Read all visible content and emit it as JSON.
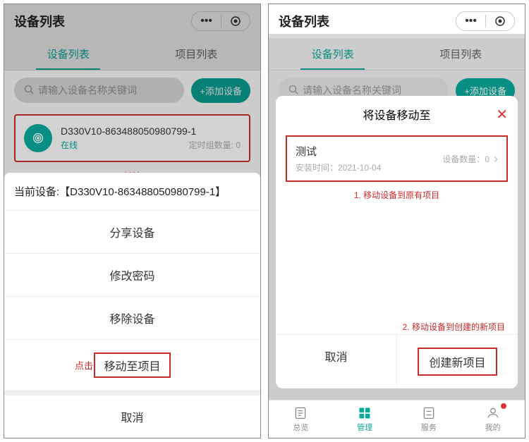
{
  "screen1": {
    "header": {
      "title": "设备列表"
    },
    "tabs": {
      "devices": "设备列表",
      "projects": "项目列表"
    },
    "search": {
      "placeholder": "请输入设备名称关键词"
    },
    "addBtn": "+添加设备",
    "deviceCard": {
      "name": "D330V10-863488050980799-1",
      "status": "在线",
      "meta": "定时组数量: 0"
    },
    "longPressLabel": "长按",
    "sheet": {
      "title": "当前设备:【D330V10-863488050980799-1】",
      "share": "分享设备",
      "changePwd": "修改密码",
      "remove": "移除设备",
      "move": "移动至项目",
      "cancel": "取消",
      "clickLabel": "点击"
    }
  },
  "screen2": {
    "header": {
      "title": "设备列表"
    },
    "tabs": {
      "devices": "设备列表",
      "projects": "项目列表"
    },
    "search": {
      "placeholder": "请输入设备名称关键词"
    },
    "addBtn": "+添加设备",
    "modal": {
      "title": "将设备移动至",
      "project": {
        "name": "测试",
        "installLabel": "安装时间：",
        "installDate": "2021-10-04",
        "countLabel": "设备数量：",
        "count": "0"
      },
      "anno1": "1. 移动设备到原有项目",
      "anno2": "2. 移动设备到创建的新项目",
      "cancel": "取消",
      "create": "创建新项目"
    },
    "nav": {
      "overview": "总览",
      "manage": "管理",
      "service": "服务",
      "mine": "我的"
    }
  }
}
